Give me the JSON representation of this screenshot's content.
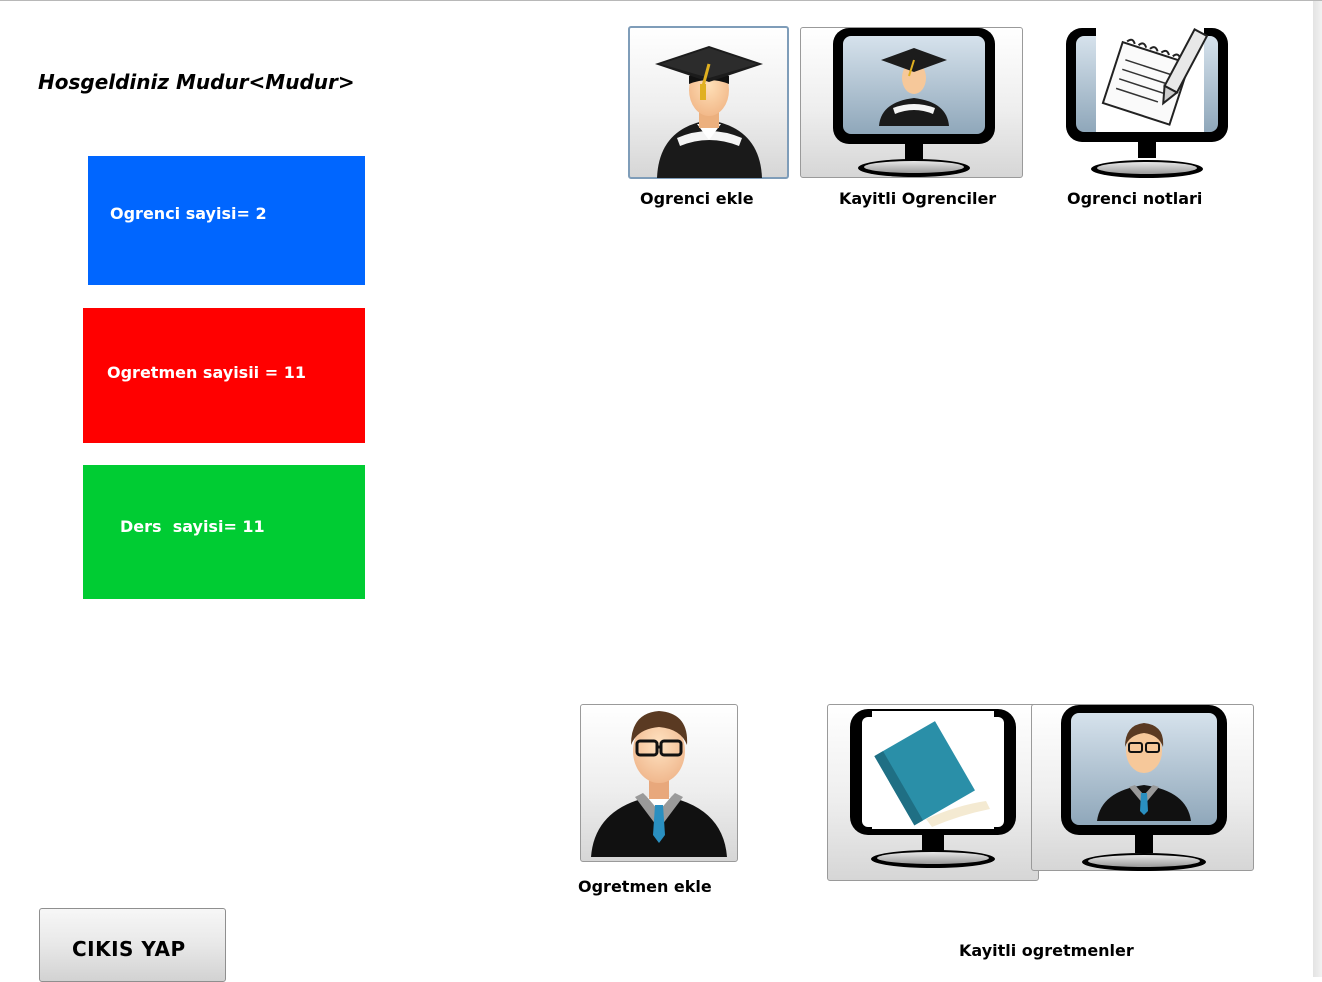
{
  "header": {
    "welcome": "Hosgeldiniz Mudur<Mudur>"
  },
  "stats": {
    "students": "Ogrenci sayisi= 2",
    "teachers": "Ogretmen sayisii = 11",
    "courses": "Ders  sayisi= 11"
  },
  "actions": {
    "add_student": "Ogrenci ekle",
    "registered_students": "Kayitli Ogrenciler",
    "student_grades": "Ogrenci notlari",
    "add_teacher": "Ogretmen ekle",
    "registered_teachers": "Kayitli ogretmenler"
  },
  "footer": {
    "exit": "CIKIS YAP"
  },
  "colors": {
    "students_tile": "#0066ff",
    "teachers_tile": "#ff0000",
    "courses_tile": "#00cc33"
  }
}
